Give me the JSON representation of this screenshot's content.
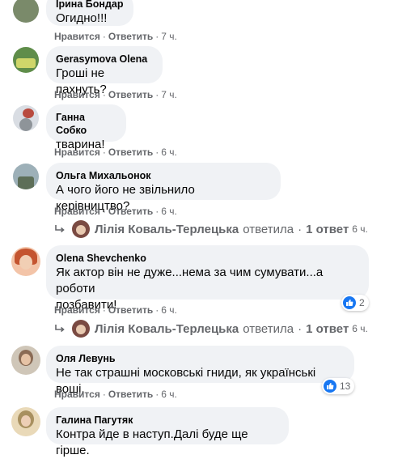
{
  "ui": {
    "like_label": "Нравится",
    "reply_label": "Ответить",
    "dot": "·"
  },
  "comments": [
    {
      "name": "Ірина Бондар",
      "text": "Огидно!!!",
      "time": "7 ч.",
      "avatar_color": "#7a8a6a"
    },
    {
      "name": "Gerasymova Olena",
      "text": "Гроші не пахнуть?",
      "time": "7 ч.",
      "avatar_color": "#5f8d4a"
    },
    {
      "name": "Ганна Собко",
      "text": "тварина!",
      "time": "6 ч.",
      "avatar_color": "#b84a3e"
    },
    {
      "name": "Ольга Михальонок",
      "text": "А чого його не звільнило керівництво?",
      "time": "6 ч.",
      "avatar_color": "#7d9aa8"
    },
    {
      "name": "Olena Shevchenko",
      "text_line1": "Як актор він не дуже...нема за чим сумувати...а роботи",
      "text_line2": "позбавити!",
      "time": "6 ч.",
      "reactions": "2",
      "avatar_color": "#c4542f"
    },
    {
      "name": "Оля Левунь",
      "text": "Не так страшні московські гниди, як українські воші.",
      "time": "6 ч.",
      "reactions": "13",
      "avatar_color": "#8a6b55"
    },
    {
      "name": "Галина Пагутяк",
      "text": "Контра йде в наступ.Далі буде ще гірше.",
      "avatar_color": "#a8905f"
    }
  ],
  "replies": [
    {
      "name": "Лілія Коваль-Терлецька",
      "verb": "ответила",
      "dot": "·",
      "count": "1 ответ",
      "time": "6 ч."
    },
    {
      "name": "Лілія Коваль-Терлецька",
      "verb": "ответила",
      "dot": "·",
      "count": "1 ответ",
      "time": "6 ч."
    }
  ]
}
